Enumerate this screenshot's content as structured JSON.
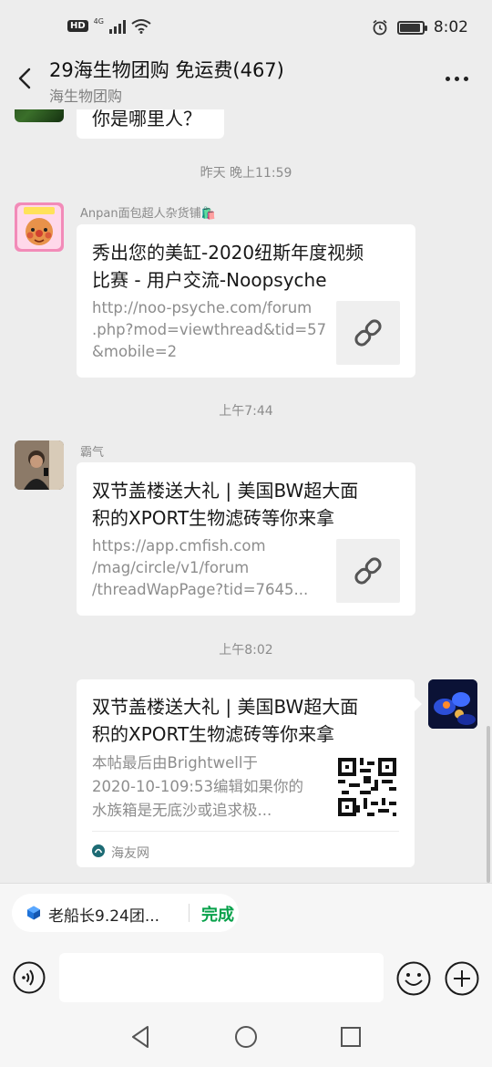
{
  "status_bar": {
    "hd": "HD",
    "network": "4G",
    "time": "8:02"
  },
  "header": {
    "title": "29海生物团购  免运费(467)",
    "subtitle": "海生物团购"
  },
  "messages": {
    "prev_partial_text": "你是哪里人？",
    "ts1": "昨天 晚上11:59",
    "msg1": {
      "sender": "Anpan面包超人杂货铺🛍️",
      "title_l1": "秀出您的美缸-2020纽斯年度视频",
      "title_l2": "比赛 - 用户交流-Noopsyche",
      "url_l1": "http://noo-psyche.com/forum",
      "url_l2": ".php?mod=viewthread&tid=57",
      "url_l3": "&mobile=2"
    },
    "ts2": "上午7:44",
    "msg2": {
      "sender": "霸气",
      "title_l1": "双节盖楼送大礼 | 美国BW超大面",
      "title_l2": "积的XPORT生物滤砖等你来拿",
      "url_l1": "https://app.cmfish.com",
      "url_l2": "/mag/circle/v1/forum",
      "url_l3": "/threadWapPage?tid=7645..."
    },
    "ts3": "上午8:02",
    "msg3": {
      "title_l1": "双节盖楼送大礼 | 美国BW超大面",
      "title_l2": "积的XPORT生物滤砖等你来拿",
      "desc_l1": "本帖最后由Brightwell于",
      "desc_l2": "2020-10-109:53编辑如果你的",
      "desc_l3": "水族箱是无底沙或追求极...",
      "source": "海友网"
    }
  },
  "quote_bar": {
    "text": "老船长9.24团...",
    "done": "完成"
  },
  "colors": {
    "background": "#ededed",
    "accent_green": "#07a14a",
    "bubble": "#ffffff"
  },
  "icons": [
    "back-arrow-icon",
    "more-icon",
    "link-icon",
    "qr-code-icon",
    "voice-icon",
    "emoji-icon",
    "plus-icon",
    "nav-back-icon",
    "nav-home-icon",
    "nav-recent-icon"
  ]
}
